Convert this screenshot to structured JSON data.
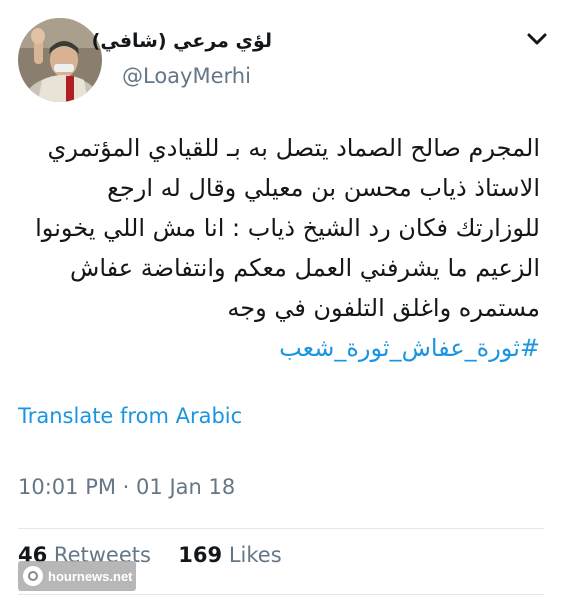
{
  "tweet": {
    "display_name": "لؤي مرعي (شافي)",
    "handle": "@LoayMerhi",
    "text_lines": [
      "المجرم صالح الصماد يتصل به بـ للقيادي المؤتمري",
      "الاستاذ ذياب محسن بن معيلي وقال له ارجع",
      "للوزارتك فكان رد الشيخ ذياب : انا مش اللي يخونوا",
      "الزعيم ما يشرفني العمل معكم  وانتفاضة عفاش",
      "مستمره  واغلق التلفون في وجه"
    ],
    "hashtags": "#ثورة_عفاش_ثورة_شعب",
    "translate_label": "Translate from Arabic",
    "time": "10:01 PM",
    "separator": "·",
    "date": "01 Jan 18",
    "retweets_count": "46",
    "retweets_label": "Retweets",
    "likes_count": "169",
    "likes_label": "Likes"
  },
  "icons": {
    "avatar": "avatar-photo",
    "menu": "chevron-down-icon"
  },
  "watermark": {
    "text": "hournews.net"
  },
  "colors": {
    "link": "#1b95e0",
    "secondary": "#657786",
    "text": "#14171a",
    "divider": "#e1e8ed"
  }
}
